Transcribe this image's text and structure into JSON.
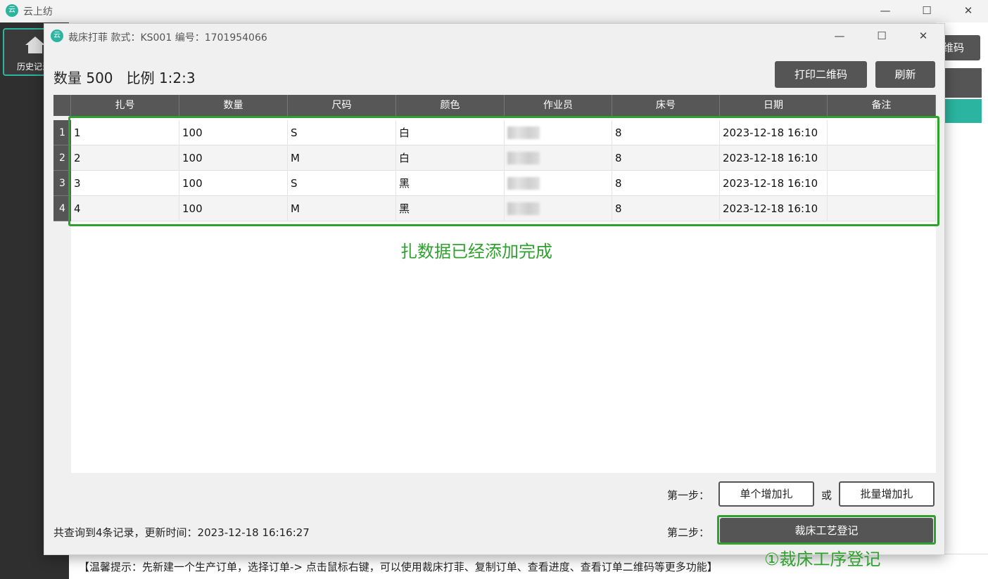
{
  "main_window": {
    "title": "云上纺",
    "logo_text": "云",
    "controls": {
      "minimize": "—",
      "maximize": "☐",
      "close": "✕"
    },
    "sidebar": {
      "history_label": "历史记录"
    },
    "background_qr_label": "维码",
    "tip": "【温馨提示：先新建一个生产订单，选择订单-> 点击鼠标右键，可以使用裁床打菲、复制订单、查看进度、查看订单二维码等更多功能】"
  },
  "dialog": {
    "title": "裁床打菲   款式：KS001   编号：1701954066",
    "logo_text": "云",
    "controls": {
      "minimize": "—",
      "maximize": "☐",
      "close": "✕"
    },
    "summary": "数量 500   比例 1:2:3",
    "buttons": {
      "print_qr": "打印二维码",
      "refresh": "刷新"
    },
    "table": {
      "columns": [
        "扎号",
        "数量",
        "尺码",
        "颜色",
        "作业员",
        "床号",
        "日期",
        "备注"
      ],
      "rows": [
        {
          "num": "1",
          "bundle": "1",
          "qty": "100",
          "size": "S",
          "color": "白",
          "operator": "",
          "bed": "8",
          "date": "2023-12-18 16:10",
          "note": ""
        },
        {
          "num": "2",
          "bundle": "2",
          "qty": "100",
          "size": "M",
          "color": "白",
          "operator": "",
          "bed": "8",
          "date": "2023-12-18 16:10",
          "note": ""
        },
        {
          "num": "3",
          "bundle": "3",
          "qty": "100",
          "size": "S",
          "color": "黑",
          "operator": "",
          "bed": "8",
          "date": "2023-12-18 16:10",
          "note": ""
        },
        {
          "num": "4",
          "bundle": "4",
          "qty": "100",
          "size": "M",
          "color": "黑",
          "operator": "",
          "bed": "8",
          "date": "2023-12-18 16:10",
          "note": ""
        }
      ]
    },
    "annotation_done": "扎数据已经添加完成",
    "step1_label": "第一步：",
    "add_single": "单个增加扎",
    "or": "或",
    "add_batch": "批量增加扎",
    "step2_label": "第二步：",
    "register": "裁床工艺登记",
    "annotation_register": "①裁床工序登记",
    "status": "共查询到4条记录，更新时间：2023-12-18 16:16:27",
    "annotation_color": "#2ea12e"
  }
}
